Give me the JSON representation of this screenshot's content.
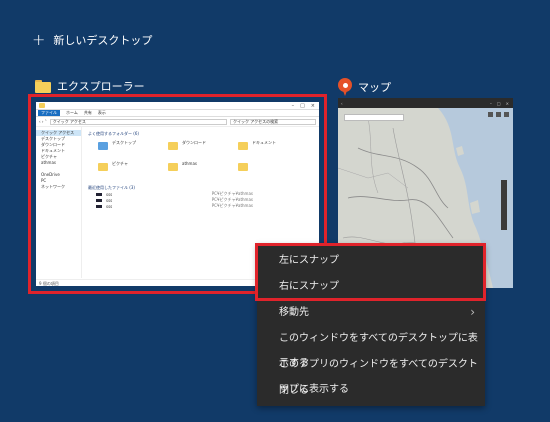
{
  "new_desktop": {
    "label": "新しいデスクトップ",
    "plus": "+"
  },
  "windows": {
    "explorer": {
      "title": "エクスプローラー",
      "thumb": {
        "ribbon_tabs": [
          "ファイル",
          "ホーム",
          "共有",
          "表示"
        ],
        "address": "クイック アクセス",
        "search_placeholder": "クイック アクセスの検索",
        "nav_items": [
          "クイック アクセス",
          "デスクトップ",
          "ダウンロード",
          "ドキュメント",
          "ピクチャ",
          "athmas",
          "",
          "OneDrive",
          "PC",
          "ネットワーク"
        ],
        "section_folders": "よく使用するフォルダー (6)",
        "folders": [
          "デスクトップ",
          "ダウンロード",
          "ドキュメント",
          "ピクチャ",
          "athmas",
          ""
        ],
        "section_files": "最近使用したファイル (3)",
        "files": [
          {
            "name": "sss",
            "path": "PC¥ピクチャ¥athmas"
          },
          {
            "name": "sss",
            "path": "PC¥ピクチャ¥athmas"
          },
          {
            "name": "sss",
            "path": "PC¥ピクチャ¥athmas"
          }
        ],
        "status": "9 個の項目"
      }
    },
    "maps": {
      "title": "マップ"
    }
  },
  "context_menu": {
    "items": [
      {
        "label": "左にスナップ"
      },
      {
        "label": "右にスナップ"
      },
      {
        "label": "移動先",
        "submenu_arrow": "›"
      },
      {
        "label": "このウィンドウをすべてのデスクトップに表示する"
      },
      {
        "label": "このアプリのウィンドウをすべてのデスクトップに表示する"
      },
      {
        "label": "閉じる"
      }
    ]
  },
  "colors": {
    "background": "#113a68",
    "highlight_border": "#e0232b",
    "menu_bg": "#2b2b2b",
    "accent_blue": "#1a6ec1"
  }
}
